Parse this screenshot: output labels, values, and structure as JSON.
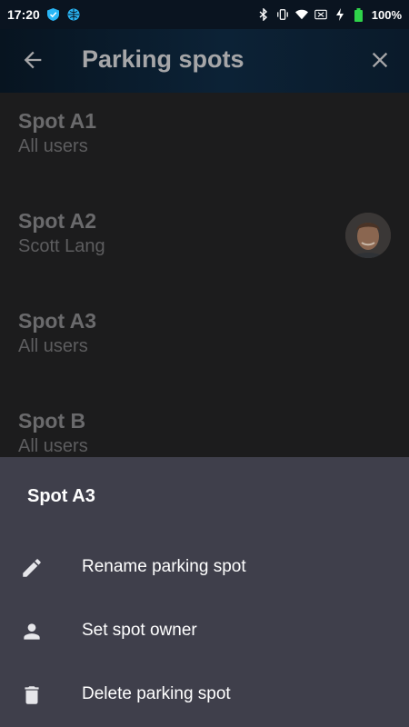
{
  "status_bar": {
    "time": "17:20",
    "battery": "100%",
    "icons": [
      "shield-icon",
      "vpn-icon",
      "bluetooth-icon",
      "vibrate-icon",
      "wifi-icon",
      "sim-icon",
      "charging-icon",
      "battery-icon"
    ]
  },
  "app_bar": {
    "title": "Parking spots",
    "back_icon": "arrow-left-icon",
    "close_icon": "close-icon"
  },
  "spots": [
    {
      "name": "Spot A1",
      "owner": "All users",
      "has_avatar": false
    },
    {
      "name": "Spot A2",
      "owner": "Scott Lang",
      "has_avatar": true
    },
    {
      "name": "Spot A3",
      "owner": "All users",
      "has_avatar": false
    },
    {
      "name": "Spot B",
      "owner": "All users",
      "has_avatar": false
    }
  ],
  "sheet": {
    "title": "Spot A3",
    "actions": [
      {
        "label": "Rename parking spot",
        "icon": "pencil-icon"
      },
      {
        "label": "Set spot owner",
        "icon": "person-icon"
      },
      {
        "label": "Delete parking spot",
        "icon": "trash-icon"
      }
    ]
  },
  "colors": {
    "appbar": "#0c2236",
    "background": "#1c1c1d",
    "sheet": "#3f3f4b",
    "battery": "#2fd34a"
  }
}
